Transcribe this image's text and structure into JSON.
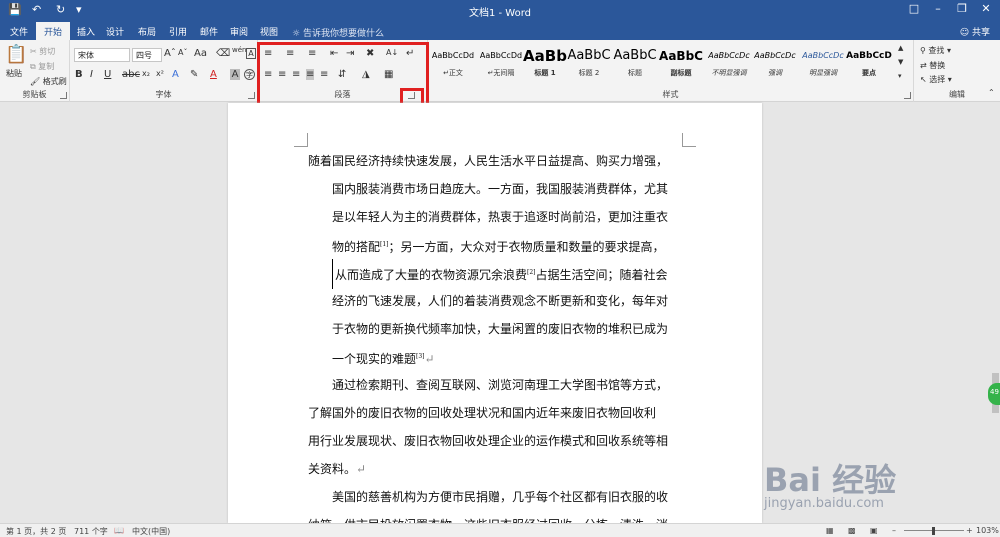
{
  "window": {
    "title": "文档1 - Word",
    "quick_access": [
      "save-icon",
      "undo-icon",
      "redo-icon",
      "customize-icon"
    ]
  },
  "tabs": [
    {
      "label": "文件"
    },
    {
      "label": "开始"
    },
    {
      "label": "插入"
    },
    {
      "label": "设计"
    },
    {
      "label": "布局"
    },
    {
      "label": "引用"
    },
    {
      "label": "邮件"
    },
    {
      "label": "审阅"
    },
    {
      "label": "视图"
    }
  ],
  "active_tab": "开始",
  "tell_me": "告诉我你想要做什么",
  "share": "共享",
  "ribbon": {
    "clipboard": {
      "label": "剪贴板",
      "paste": "粘贴",
      "cut": "剪切",
      "copy": "复制",
      "format_painter": "格式刷"
    },
    "font": {
      "label": "字体",
      "font_name": "宋体",
      "font_size": "四号",
      "aa": "Aa",
      "wen": "wén",
      "a_label": "A",
      "b": "B",
      "i": "I",
      "u": "U",
      "x2": "x₂",
      "x2sup": "x²"
    },
    "paragraph": {
      "label": "段落"
    },
    "styles": {
      "label": "样式",
      "items": [
        {
          "preview": "AaBbCcDd",
          "name": "↵正文"
        },
        {
          "preview": "AaBbCcDd",
          "name": "↵无间隔"
        },
        {
          "preview": "AaBb",
          "name": "标题 1"
        },
        {
          "preview": "AaBbC",
          "name": "标题 2"
        },
        {
          "preview": "AaBbC",
          "name": "标题"
        },
        {
          "preview": "AaBbC",
          "name": "副标题"
        },
        {
          "preview": "AaBbCcDc",
          "name": "不明显强调"
        },
        {
          "preview": "AaBbCcDc",
          "name": "强调"
        },
        {
          "preview": "AaBbCcDc",
          "name": "明显强调"
        },
        {
          "preview": "AaBbCcD",
          "name": "要点"
        }
      ]
    },
    "editing": {
      "label": "编辑",
      "find": "查找",
      "replace": "替换",
      "select": "选择"
    }
  },
  "document": {
    "lines": [
      "随着国民经济持续快速发展，人民生活水平日益提高、购买力增强，",
      "国内服装消费市场日趋庞大。一方面，我国服装消费群体，尤其",
      "是以年轻人为主的消费群体，热衷于追逐时尚前沿，更加注重衣",
      "物的搭配",
      "；另一方面，大众对于衣物质量和数量的要求提高，",
      "从而造成了大量的衣物资源冗余浪费",
      "占据生活空间；随着社会",
      "经济的飞速发展，人们的着装消费观念不断更新和变化，每年对",
      "于衣物的更新换代频率加快，大量闲置的废旧衣物的堆积已成为",
      "一个现实的难题",
      "通过检索期刊、查阅互联网、浏览河南理工大学图书馆等方式，",
      "了解国外的废旧衣物的回收处理状况和国内近年来废旧衣物回收利",
      "用行业发展现状、废旧衣物回收处理企业的运作模式和回收系统等相",
      "关资料。",
      "美国的慈善机构为方便市民捐赠，几乎每个社区都有旧衣服的收",
      "纳箱，供市民投放闲置衣物，这些旧衣服经过回收、分拣、清洗、消"
    ],
    "ref1": "[1]",
    "ref2": "[2]",
    "ref3": "[3]",
    "mark": "↵"
  },
  "status": {
    "page": "第 1 页，共 2 页",
    "words": "711 个字",
    "language": "中文(中国)",
    "zoom": "103%"
  },
  "watermark": {
    "brand": "Bai 经验",
    "url": "jingyan.baidu.com"
  },
  "badge": "49"
}
